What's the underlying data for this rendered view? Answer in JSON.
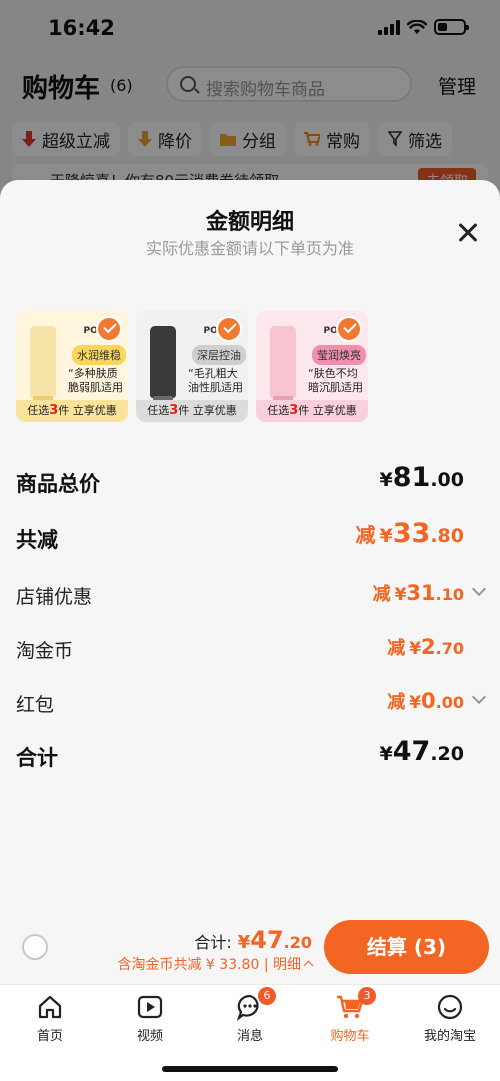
{
  "status_bar": {
    "time": "16:42"
  },
  "cart_header": {
    "title": "购物车",
    "count": "(6)",
    "search_placeholder": "搜索购物车商品",
    "manage": "管理"
  },
  "filter_chips": [
    "超级立减",
    "降价",
    "分组",
    "常购",
    "筛选"
  ],
  "notice": {
    "text": "天降惊喜！你有80元消费券待领取",
    "button": "去领取"
  },
  "sheet": {
    "title": "金额明细",
    "subtitle": "实际优惠金额请以下单页为准"
  },
  "products": [
    {
      "brand": "POND'S",
      "tag": "水润维稳",
      "desc": "“多种肤质 脆弱肌适用",
      "footer_pre": "任选",
      "footer_num": "3",
      "footer_post": "件 立享优惠",
      "tube_color": "#f5e3a8",
      "tag_bg": "#f7d65a",
      "bg": "#fff6dd",
      "footer_bg": "#f9e39a",
      "cap": "#e8cf72"
    },
    {
      "brand": "POND'S",
      "tag": "深层控油",
      "desc": "“毛孔粗大 油性肌适用",
      "footer_pre": "任选",
      "footer_num": "3",
      "footer_post": "件 立享优惠",
      "tube_color": "#3a3a3a",
      "tag_bg": "#cfcfcf",
      "bg": "#f1f1f1",
      "footer_bg": "#dcdcdc",
      "cap": "#6a6a6a"
    },
    {
      "brand": "POND'S",
      "tag": "莹润焕亮",
      "desc": "“肤色不均 暗沉肌适用",
      "footer_pre": "任选",
      "footer_num": "3",
      "footer_post": "件 立享优惠",
      "tube_color": "#f6c3cf",
      "tag_bg": "#f08fb0",
      "bg": "#fde8ee",
      "footer_bg": "#f9cfdc",
      "cap": "#ee9db4"
    }
  ],
  "rows": {
    "goods_total": {
      "label": "商品总价",
      "cur": "¥",
      "int": "81",
      "dec": ".00"
    },
    "total_off": {
      "label": "共减",
      "prefix": "减",
      "cur": "¥",
      "int": "33",
      "dec": ".80"
    },
    "shop_discount": {
      "label": "店铺优惠",
      "prefix": "减",
      "cur": "¥",
      "int": "31",
      "dec": ".10"
    },
    "taojinbi": {
      "label": "淘金币",
      "prefix": "减",
      "cur": "¥",
      "int": "2",
      "dec": ".70"
    },
    "red_packet": {
      "label": "红包",
      "prefix": "减",
      "cur": "¥",
      "int": "0",
      "dec": ".00"
    },
    "sum": {
      "label": "合计",
      "cur": "¥",
      "int": "47",
      "dec": ".20"
    }
  },
  "checkout": {
    "total_label": "合计:",
    "total_cur": "¥",
    "total_int": "47",
    "total_dec": ".20",
    "coin_text": "含淘金币共减 ¥ 33.80",
    "detail": "明细",
    "pay_button": "结算 (3)"
  },
  "tabs": [
    {
      "label": "首页",
      "icon": "home-icon",
      "badge": ""
    },
    {
      "label": "视频",
      "icon": "video-icon",
      "badge": ""
    },
    {
      "label": "消息",
      "icon": "message-icon",
      "badge": "6"
    },
    {
      "label": "购物车",
      "icon": "cart-icon",
      "badge": "3",
      "active": true
    },
    {
      "label": "我的淘宝",
      "icon": "profile-icon",
      "badge": ""
    }
  ],
  "colors": {
    "accent": "#f26522",
    "sheet_bg": "#f6f6f6"
  }
}
